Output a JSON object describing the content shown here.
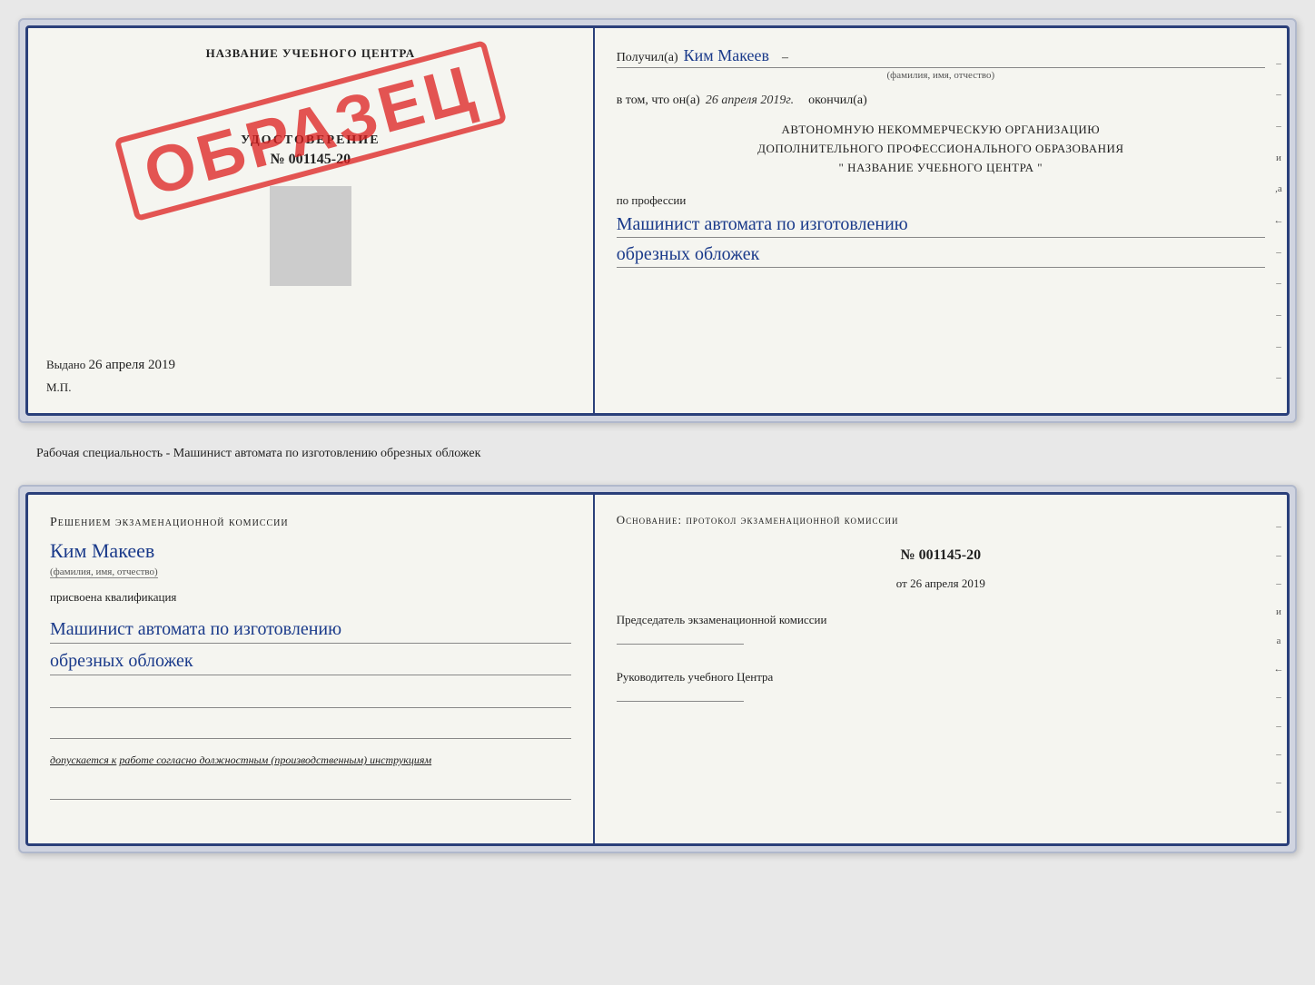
{
  "page": {
    "background_color": "#e8e8e8"
  },
  "top_document": {
    "left": {
      "title": "НАЗВАНИЕ УЧЕБНОГО ЦЕНТРА",
      "stamp": "ОБРАЗЕЦ",
      "udostoverenie_label": "УДОСТОВЕРЕНИЕ",
      "number": "№ 001145-20",
      "vydano_label": "Выдано",
      "vydano_date": "26 апреля 2019",
      "mp_label": "М.П."
    },
    "right": {
      "poluchil_label": "Получил(а)",
      "name": "Ким Макеев",
      "fio_label": "(фамилия, имя, отчество)",
      "vtom_label": "в том, что он(а)",
      "date_value": "26 апреля 2019г.",
      "okonchil_label": "окончил(а)",
      "org_line1": "АВТОНОМНУЮ НЕКОММЕРЧЕСКУЮ ОРГАНИЗАЦИЮ",
      "org_line2": "ДОПОЛНИТЕЛЬНОГО ПРОФЕССИОНАЛЬНОГО ОБРАЗОВАНИЯ",
      "org_line3": "\"  НАЗВАНИЕ УЧЕБНОГО ЦЕНТРА  \"",
      "po_professii_label": "по профессии",
      "profession_line1": "Машинист автомата по изготовлению",
      "profession_line2": "обрезных обложек",
      "side_marks": [
        "–",
        "–",
        "–",
        "и",
        ",а",
        "←",
        "–",
        "–",
        "–",
        "–",
        "–"
      ]
    }
  },
  "middle_caption": {
    "text": "Рабочая специальность - Машинист автомата по изготовлению обрезных обложек"
  },
  "bottom_document": {
    "left": {
      "resheniem_label": "Решением экзаменационной комиссии",
      "name": "Ким Макеев",
      "fio_label": "(фамилия, имя, отчество)",
      "prisvoena_label": "присвоена квалификация",
      "qual_line1": "Машинист автомата по изготовлению",
      "qual_line2": "обрезных обложек",
      "dopuskaetsya_prefix": "допускается к",
      "dopuskaetsya_underline": "работе согласно должностным (производственным) инструкциям"
    },
    "right": {
      "osnovanie_label": "Основание: протокол экзаменационной комиссии",
      "number": "№ 001145-20",
      "ot_prefix": "от",
      "date_value": "26 апреля 2019",
      "predsedatel_label": "Председатель экзаменационной комиссии",
      "rukovoditel_label": "Руководитель учебного Центра",
      "side_marks": [
        "–",
        "–",
        "–",
        "и",
        "а",
        "←",
        "–",
        "–",
        "–",
        "–",
        "–"
      ]
    }
  }
}
